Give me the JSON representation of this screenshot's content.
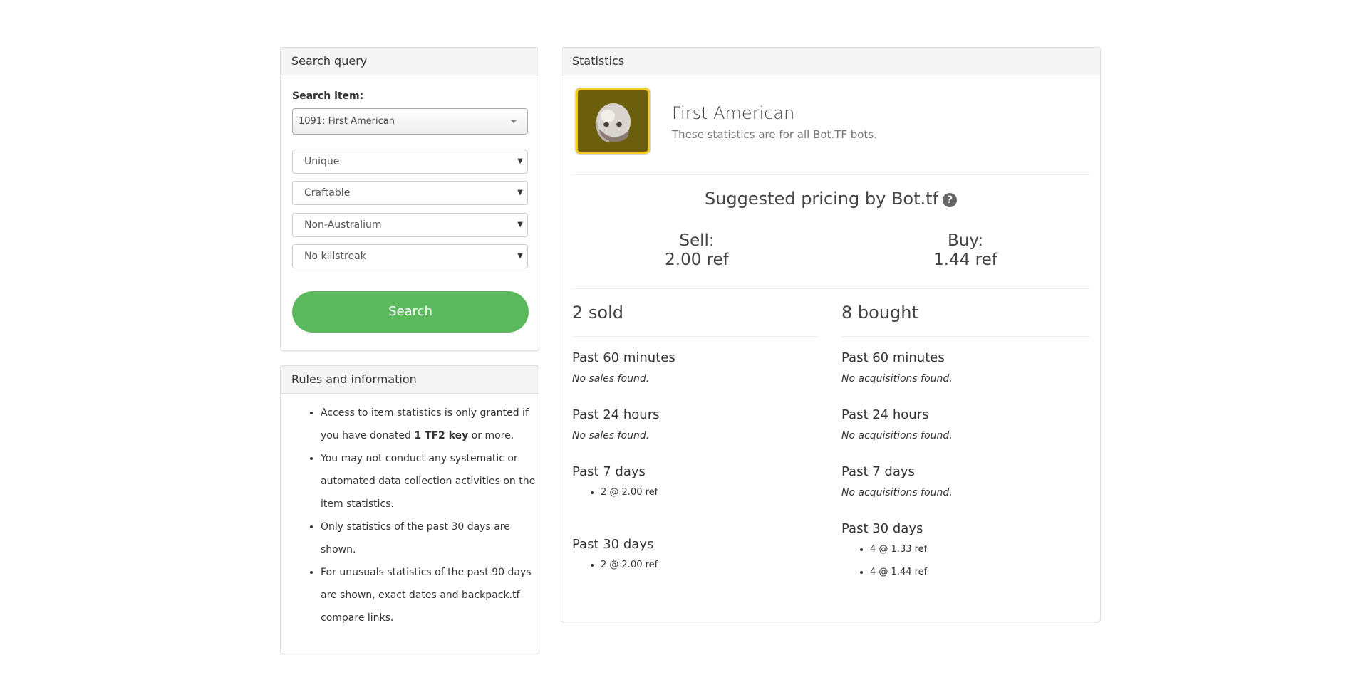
{
  "search_panel": {
    "title": "Search query",
    "item_label": "Search item:",
    "item_value": "1091: First American",
    "filters": [
      {
        "name": "quality",
        "value": "Unique"
      },
      {
        "name": "craftable",
        "value": "Craftable"
      },
      {
        "name": "australium",
        "value": "Non-Australium"
      },
      {
        "name": "killstreak",
        "value": "No killstreak"
      }
    ],
    "search_button": "Search"
  },
  "rules_panel": {
    "title": "Rules and information",
    "rules": [
      {
        "pre": "Access to item statistics is only granted if you have donated ",
        "bold": "1 TF2 key",
        "post": " or more."
      },
      {
        "pre": "You may not conduct any systematic or automated data collection activities on the item statistics.",
        "bold": "",
        "post": ""
      },
      {
        "pre": "Only statistics of the past 30 days are shown.",
        "bold": "",
        "post": ""
      },
      {
        "pre": "For unusuals statistics of the past 90 days are shown, exact dates and backpack.tf compare links.",
        "bold": "",
        "post": ""
      }
    ]
  },
  "stats_panel": {
    "title": "Statistics",
    "item_name": "First American",
    "item_subtitle": "These statistics are for all Bot.TF bots.",
    "item_icon": "helmet-icon",
    "icon_border_color": "#f4cc1a",
    "icon_bg_color": "#6b5f0e",
    "suggested_title": "Suggested pricing by Bot.tf",
    "help_icon": "?",
    "sell_label": "Sell:",
    "sell_value": "2.00 ref",
    "buy_label": "Buy:",
    "buy_value": "1.44 ref",
    "sold": {
      "heading": "2 sold",
      "past_60": {
        "label": "Past 60 minutes",
        "empty": "No sales found."
      },
      "past_24": {
        "label": "Past 24 hours",
        "empty": "No sales found."
      },
      "past_7": {
        "label": "Past 7 days",
        "entries": [
          "2 @ 2.00 ref"
        ]
      },
      "past_30": {
        "label": "Past 30 days",
        "entries": [
          "2 @ 2.00 ref"
        ]
      }
    },
    "bought": {
      "heading": "8 bought",
      "past_60": {
        "label": "Past 60 minutes",
        "empty": "No acquisitions found."
      },
      "past_24": {
        "label": "Past 24 hours",
        "empty": "No acquisitions found."
      },
      "past_7": {
        "label": "Past 7 days",
        "empty": "No acquisitions found."
      },
      "past_30": {
        "label": "Past 30 days",
        "entries": [
          "4 @ 1.33 ref",
          "4 @ 1.44 ref"
        ]
      }
    }
  },
  "colors": {
    "search_button": "#5cb85c",
    "panel_heading_bg": "#f5f5f5",
    "panel_border": "#dddddd"
  }
}
